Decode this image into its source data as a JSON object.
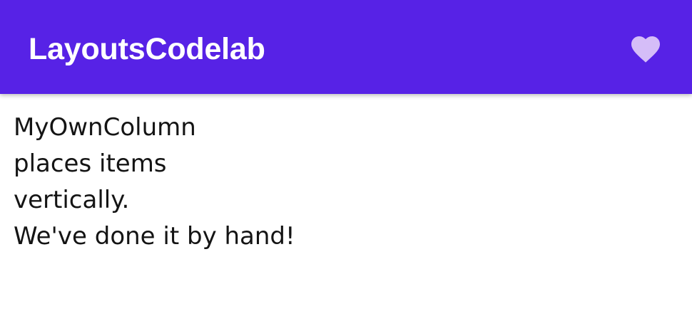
{
  "app_bar": {
    "title": "LayoutsCodelab",
    "background_color": "#5722E6",
    "title_color": "#FFFFFF",
    "action": {
      "icon": "heart-icon",
      "color": "#D5BDF8"
    }
  },
  "content": {
    "lines": [
      "MyOwnColumn",
      "places items",
      "vertically.",
      "We've done it by hand!"
    ],
    "text_color": "#141414"
  }
}
